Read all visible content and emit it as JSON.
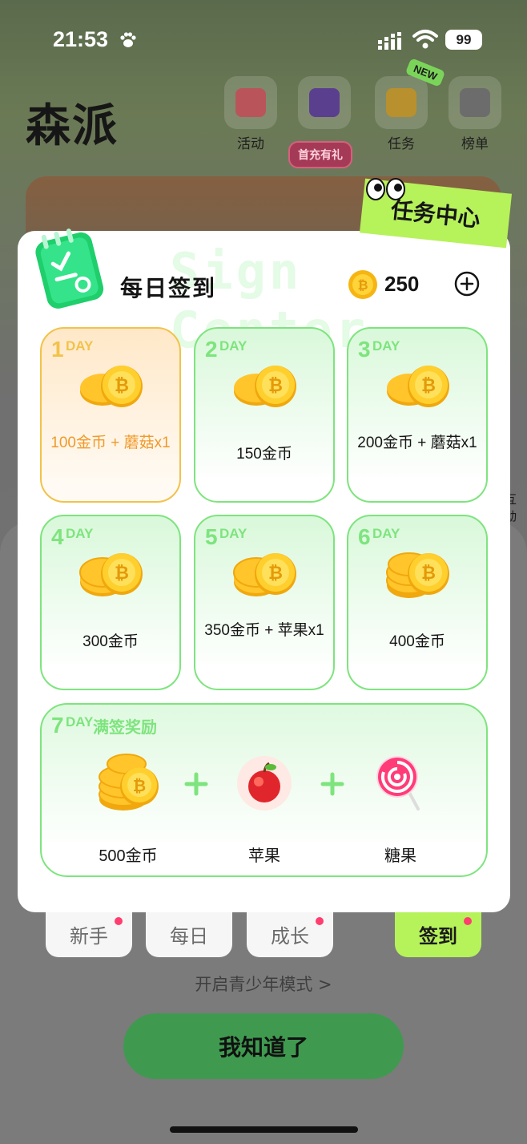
{
  "status_bar": {
    "time": "21:53",
    "battery": "99"
  },
  "app": {
    "title": "森派",
    "top_nav": [
      {
        "label": "活动",
        "icon": "gift-box-icon"
      },
      {
        "label": "",
        "icon": "treasure-chest-icon"
      },
      {
        "label": "任务",
        "icon": "calendar-check-icon"
      },
      {
        "label": "榜单",
        "icon": "leaderboard-icon"
      }
    ],
    "new_badge": "NEW",
    "first_pay_badge": "首充有礼",
    "side_label": "互动"
  },
  "modal": {
    "tag": "任务中心",
    "watermark": "Sign Center",
    "title": "每日签到",
    "coin_balance": "250",
    "day_unit": "DAY",
    "days": [
      {
        "num": "1",
        "reward": "100金币 + 蘑菇x1",
        "today": true
      },
      {
        "num": "2",
        "reward": "150金币",
        "today": false
      },
      {
        "num": "3",
        "reward": "200金币 + 蘑菇x1",
        "today": false
      },
      {
        "num": "4",
        "reward": "300金币",
        "today": false
      },
      {
        "num": "5",
        "reward": "350金币 + 苹果x1",
        "today": false
      },
      {
        "num": "6",
        "reward": "400金币",
        "today": false
      }
    ],
    "day7": {
      "num": "7",
      "subtitle": "满签奖励",
      "rewards": [
        {
          "label": "500金币",
          "icon": "coin-stack-icon"
        },
        {
          "label": "苹果",
          "icon": "apple-icon"
        },
        {
          "label": "糖果",
          "icon": "lollipop-icon"
        }
      ]
    }
  },
  "tabs": [
    {
      "label": "新手",
      "dot": true,
      "active": false
    },
    {
      "label": "每日",
      "dot": false,
      "active": false
    },
    {
      "label": "成长",
      "dot": true,
      "active": false
    },
    {
      "label": "签到",
      "dot": true,
      "active": true
    }
  ],
  "teen_mode_link": "开启青少年模式 >",
  "confirm_button": "我知道了",
  "colors": {
    "accent_green": "#7ee47e",
    "tag_lime": "#b6f25a",
    "today_orange": "#f09a2a",
    "confirm_green": "#3f9a4f"
  }
}
